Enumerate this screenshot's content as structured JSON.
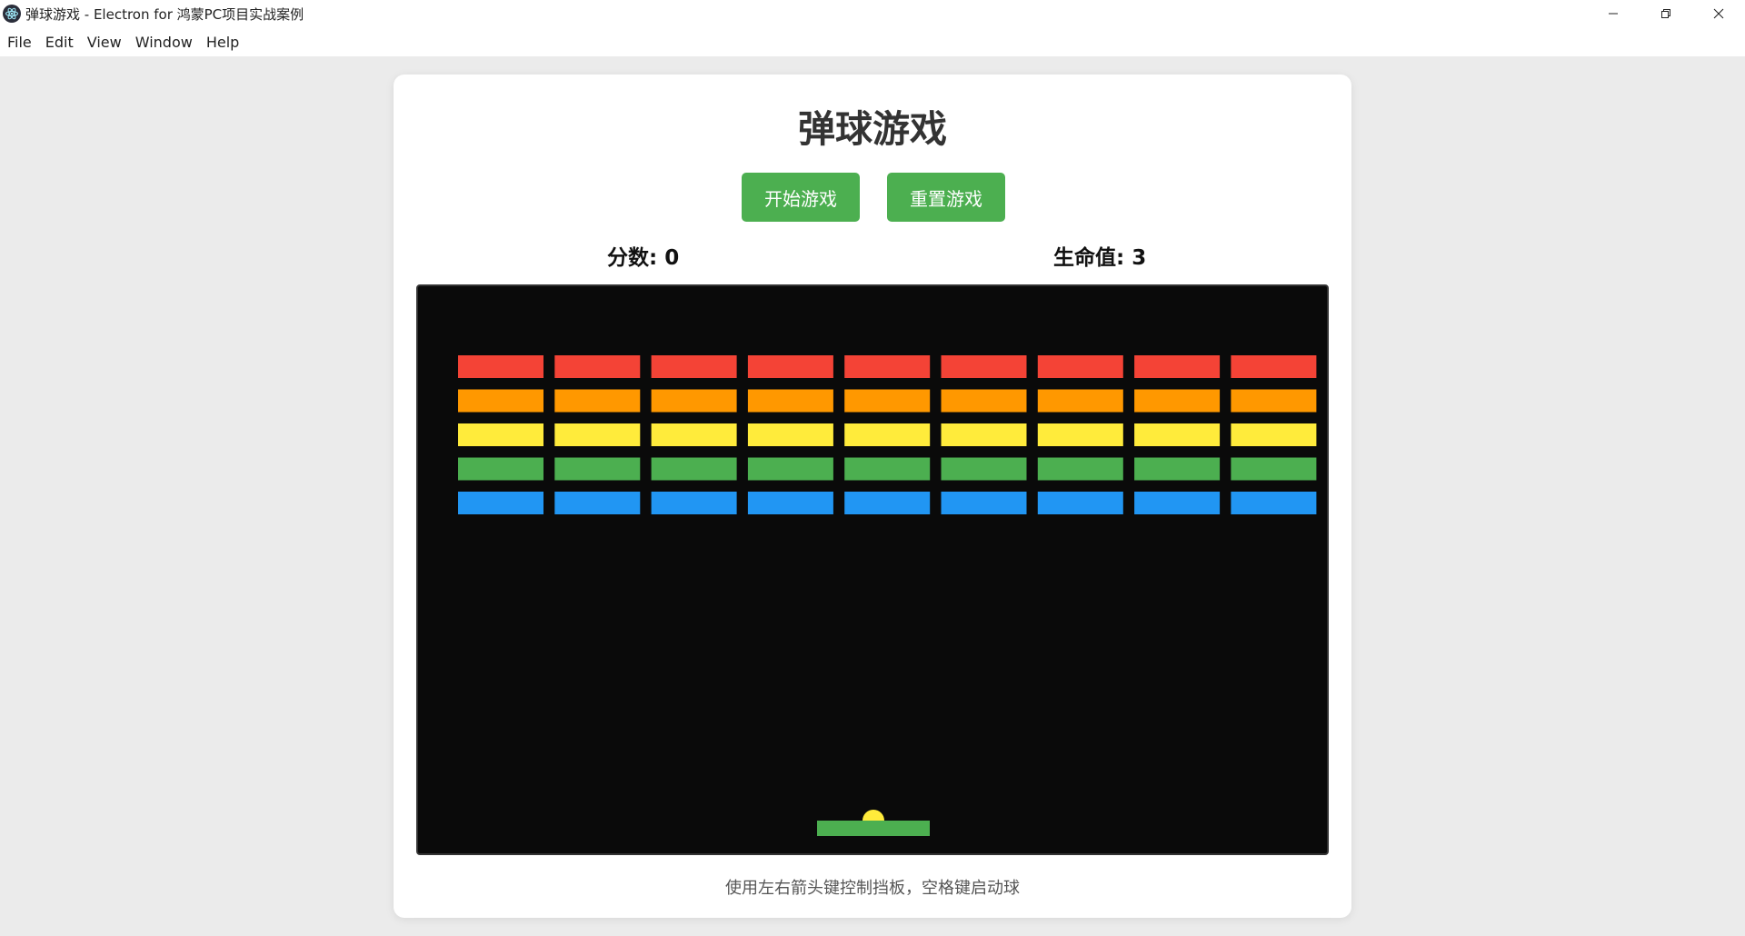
{
  "window": {
    "title": "弹球游戏 - Electron for 鸿蒙PC项目实战案例"
  },
  "menu": [
    "File",
    "Edit",
    "View",
    "Window",
    "Help"
  ],
  "game": {
    "title": "弹球游戏",
    "start_label": "开始游戏",
    "reset_label": "重置游戏",
    "score_text": "分数: 0",
    "lives_text": "生命值: 3",
    "hint": "使用左右箭头键控制挡板，空格键启动球"
  },
  "board": {
    "brick_columns": 9,
    "brick_row_colors": [
      "#f44336",
      "#ff9800",
      "#ffeb3b",
      "#4caf50",
      "#2196f3"
    ],
    "paddle_color": "#4caf50",
    "ball_color": "#ffeb3b",
    "background": "#0a0a0a"
  },
  "colors": {
    "button": "#4caf50",
    "button_text": "#ffffff"
  }
}
